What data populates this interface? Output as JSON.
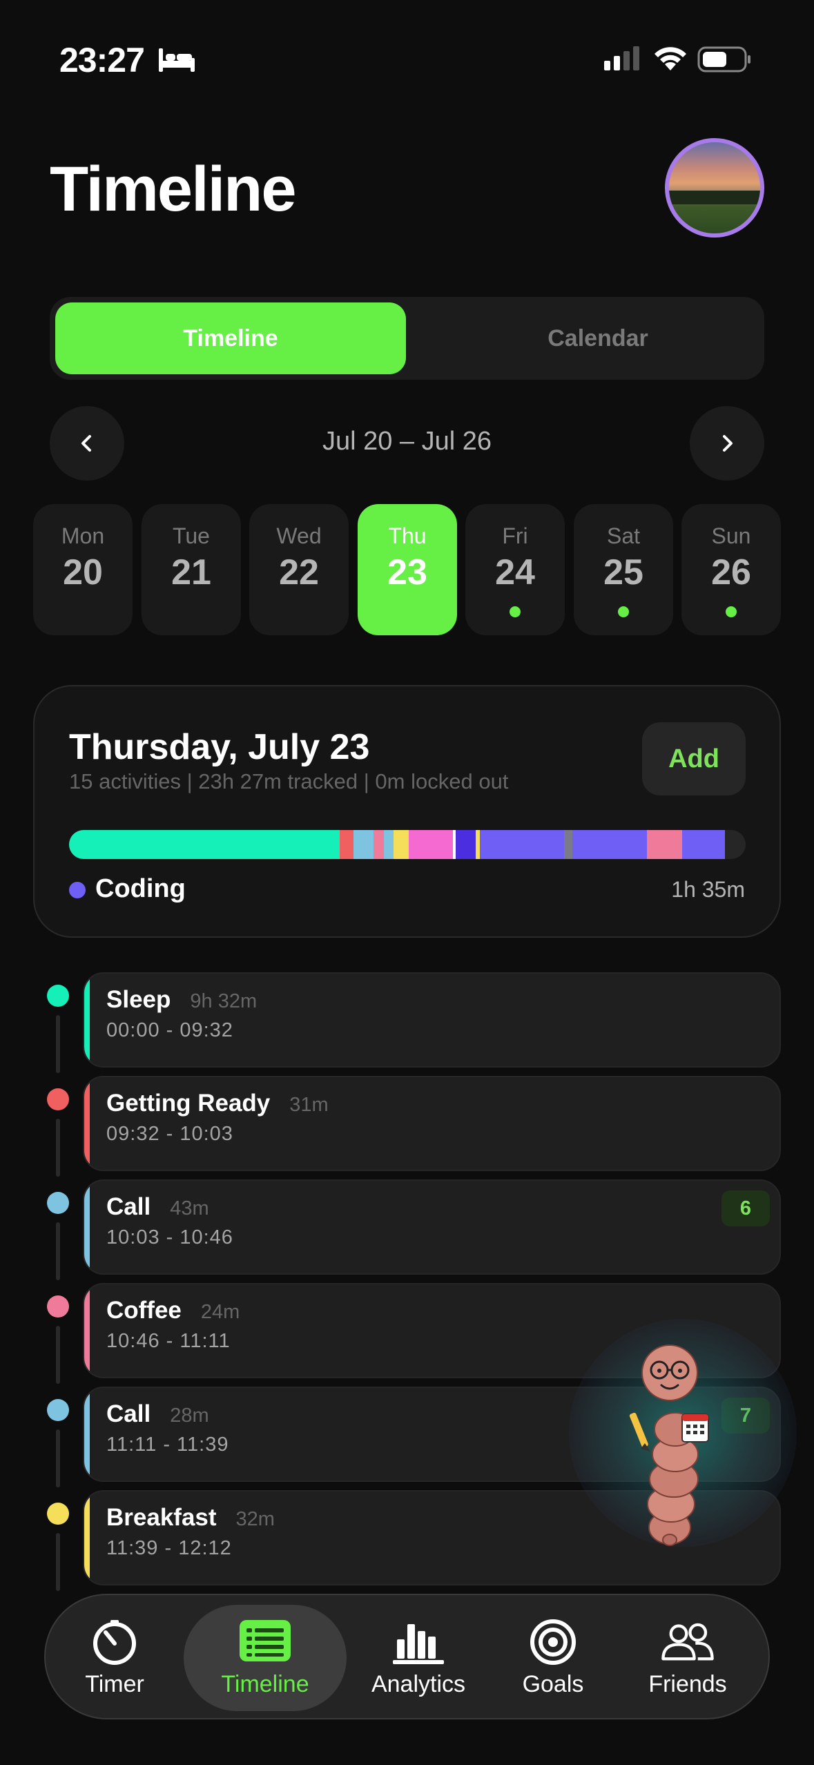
{
  "status_bar": {
    "time": "23:27",
    "icons": [
      "bed-icon",
      "cellular-signal-icon",
      "wifi-icon",
      "battery-icon"
    ]
  },
  "header": {
    "title": "Timeline",
    "avatar": "profile-avatar"
  },
  "segmented": {
    "options": [
      "Timeline",
      "Calendar"
    ],
    "selected": "Timeline"
  },
  "week": {
    "range": "Jul 20 – Jul 26",
    "days": [
      {
        "name": "Mon",
        "num": "20",
        "dot": false
      },
      {
        "name": "Tue",
        "num": "21",
        "dot": false
      },
      {
        "name": "Wed",
        "num": "22",
        "dot": false
      },
      {
        "name": "Thu",
        "num": "23",
        "dot": false,
        "selected": true
      },
      {
        "name": "Fri",
        "num": "24",
        "dot": true
      },
      {
        "name": "Sat",
        "num": "25",
        "dot": true
      },
      {
        "name": "Sun",
        "num": "26",
        "dot": true
      }
    ]
  },
  "summary": {
    "title": "Thursday, July 23",
    "subtitle": "15 activities | 23h 27m tracked | 0m locked out",
    "add_label": "Add",
    "legend": {
      "label": "Coding",
      "value": "1h 35m",
      "color": "#6f5ff5"
    },
    "bar_segments": [
      {
        "color": "#14f0b8",
        "fraction": 0.4
      },
      {
        "color": "#f06060",
        "fraction": 0.02
      },
      {
        "color": "#7ec3e0",
        "fraction": 0.03
      },
      {
        "color": "#f07a9a",
        "fraction": 0.015
      },
      {
        "color": "#7ec3e0",
        "fraction": 0.015
      },
      {
        "color": "#f5de5a",
        "fraction": 0.022
      },
      {
        "color": "#f56ad0",
        "fraction": 0.065
      },
      {
        "color": "#ffffff",
        "fraction": 0.004
      },
      {
        "color": "#4a2ee0",
        "fraction": 0.03
      },
      {
        "color": "#f5de5a",
        "fraction": 0.006
      },
      {
        "color": "#6f5ff5",
        "fraction": 0.125
      },
      {
        "color": "#7a7a8a",
        "fraction": 0.012
      },
      {
        "color": "#6f5ff5",
        "fraction": 0.11
      },
      {
        "color": "#f07a9a",
        "fraction": 0.052
      },
      {
        "color": "#6f5ff5",
        "fraction": 0.064
      },
      {
        "color": "#262626",
        "fraction": 0.019
      }
    ]
  },
  "activities": [
    {
      "name": "Sleep",
      "duration": "9h 32m",
      "range": "00:00 - 09:32",
      "color": "#14f0b8",
      "badge": ""
    },
    {
      "name": "Getting Ready",
      "duration": "31m",
      "range": "09:32 - 10:03",
      "color": "#f06060",
      "badge": ""
    },
    {
      "name": "Call",
      "duration": "43m",
      "range": "10:03 - 10:46",
      "color": "#7ec3e0",
      "badge": "6"
    },
    {
      "name": "Coffee",
      "duration": "24m",
      "range": "10:46 - 11:11",
      "color": "#f07a9a",
      "badge": ""
    },
    {
      "name": "Call",
      "duration": "28m",
      "range": "11:11 - 11:39",
      "color": "#7ec3e0",
      "badge": "7"
    },
    {
      "name": "Breakfast",
      "duration": "32m",
      "range": "11:39 - 12:12",
      "color": "#f5de5a",
      "badge": ""
    }
  ],
  "tabbar": {
    "tabs": [
      {
        "label": "Timer",
        "icon": "timer-icon"
      },
      {
        "label": "Timeline",
        "icon": "timeline-icon",
        "active": true
      },
      {
        "label": "Analytics",
        "icon": "analytics-icon"
      },
      {
        "label": "Goals",
        "icon": "goals-icon"
      },
      {
        "label": "Friends",
        "icon": "friends-icon"
      }
    ]
  },
  "colors": {
    "accent": "#66ef44",
    "background": "#0d0d0d",
    "card": "#1f1f1f"
  }
}
